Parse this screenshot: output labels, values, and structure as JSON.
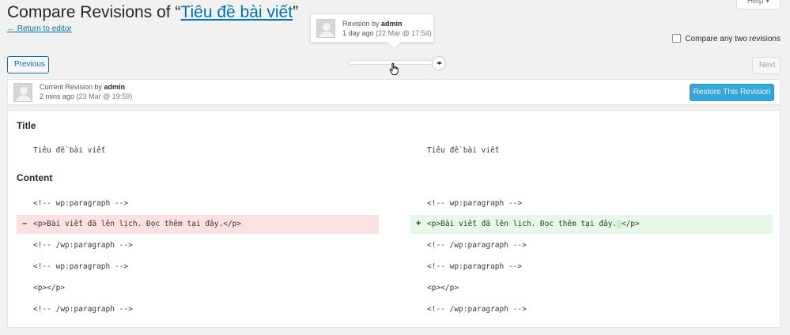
{
  "header": {
    "title_prefix": "Compare Revisions of “",
    "post_title": "Tiêu đề bài viết",
    "title_suffix": "”",
    "return_link": "← Return to editor",
    "help_label": "Help ▾"
  },
  "tooltip": {
    "revision_by": "Revision by ",
    "author": "admin",
    "time_ago": "1 day ago",
    "date": "(22 Mar @ 17:54)"
  },
  "compare_any_two": "Compare any two revisions",
  "nav": {
    "previous": "Previous",
    "next": "Next",
    "slider_handle_glyph": "◂▸",
    "slider_position_fraction": 0.5
  },
  "current_revision": {
    "label": "Current Revision by ",
    "author": "admin",
    "time_ago": "2 mins ago",
    "date": "(23 Mar @ 19:59)",
    "restore_button": "Restore This Revision"
  },
  "diff": {
    "title_heading": "Title",
    "title_left": "Tiêu đề bài viết",
    "title_right": "Tiêu đề bài viết",
    "content_heading": "Content",
    "lines_left": [
      "<!-- wp:paragraph -->",
      "<p>Bài viết đã lên lịch. Đọc thêm tại đây.</p>",
      "<!-- /wp:paragraph -->",
      "<!-- wp:paragraph -->",
      "<p></p>",
      "<!-- /wp:paragraph -->"
    ],
    "lines_right": [
      "<!-- wp:paragraph -->",
      "<p>Bài viết đã lên lịch. Đọc thêm tại đây.",
      "<!-- /wp:paragraph -->",
      "<!-- wp:paragraph -->",
      "<p></p>",
      "<!-- /wp:paragraph -->"
    ],
    "added_space": " ",
    "right_line2_tail": " </p>",
    "del_sign": "–",
    "add_sign": "+"
  },
  "colors": {
    "link": "#0073aa",
    "deleted_bg": "#fbe1e1",
    "added_bg": "#e6f8e6",
    "restore_button_bg": "#35a6d8"
  }
}
